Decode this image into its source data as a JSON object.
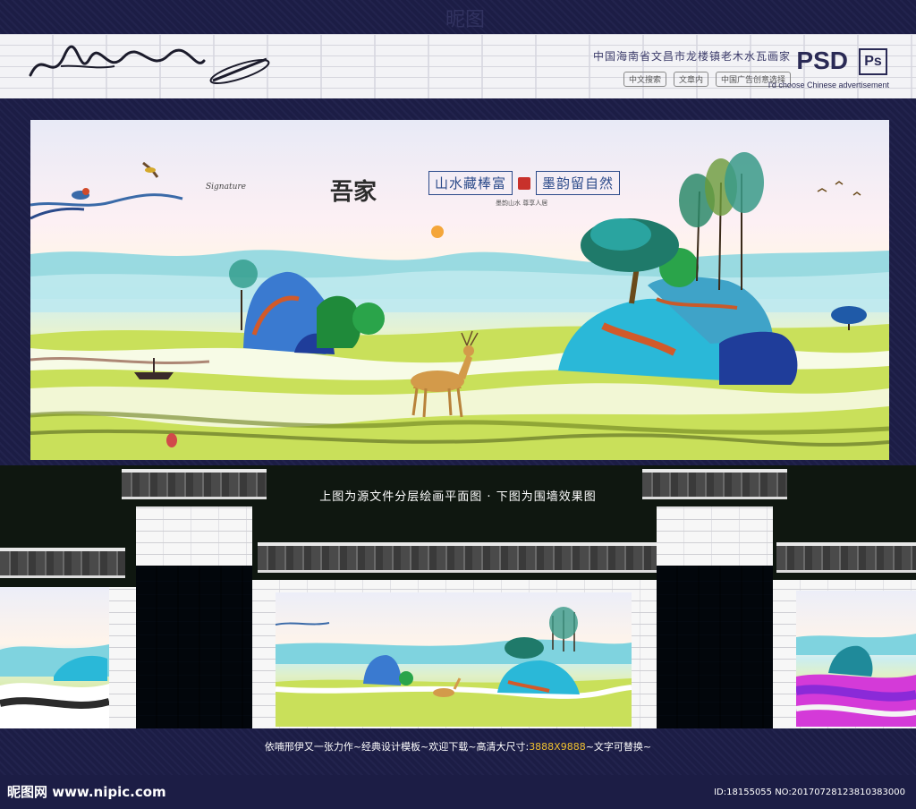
{
  "header": {
    "top_watermark": "昵图",
    "signature": "依喃邢伊",
    "top_title": "中国海南省文昌市龙楼镇老木水瓦画家",
    "row_items": [
      "中文搜索",
      "文章内",
      "中国广告创意选择"
    ],
    "psd_label": "PSD",
    "ps_icon": "Ps",
    "ps_sub": "I'd choose Chinese advertisement"
  },
  "painting": {
    "title": "吾家",
    "slogan": "山水藏棒富",
    "slogan2": "墨韵留自然",
    "brand_small": "Signature",
    "slogan_sub": "墨韵山水 尊享人居"
  },
  "captions": {
    "top": "上图为源文件分层绘画平面图 · 下图为围墙效果图",
    "bottom_prefix": "依喃邢伊又一张力作~经典设计模板~欢迎下载~高清大尺寸:",
    "bottom_size": "3888X9888",
    "bottom_suffix": "~文字可替换~"
  },
  "footer": {
    "site": "昵图网 www.nipic.com",
    "id_text": "ID:18155055 NO:20170728123810383000"
  },
  "colors": {
    "frame": "#1c1d45",
    "accent_gold": "#f2c230",
    "seal_red": "#c8312b"
  }
}
